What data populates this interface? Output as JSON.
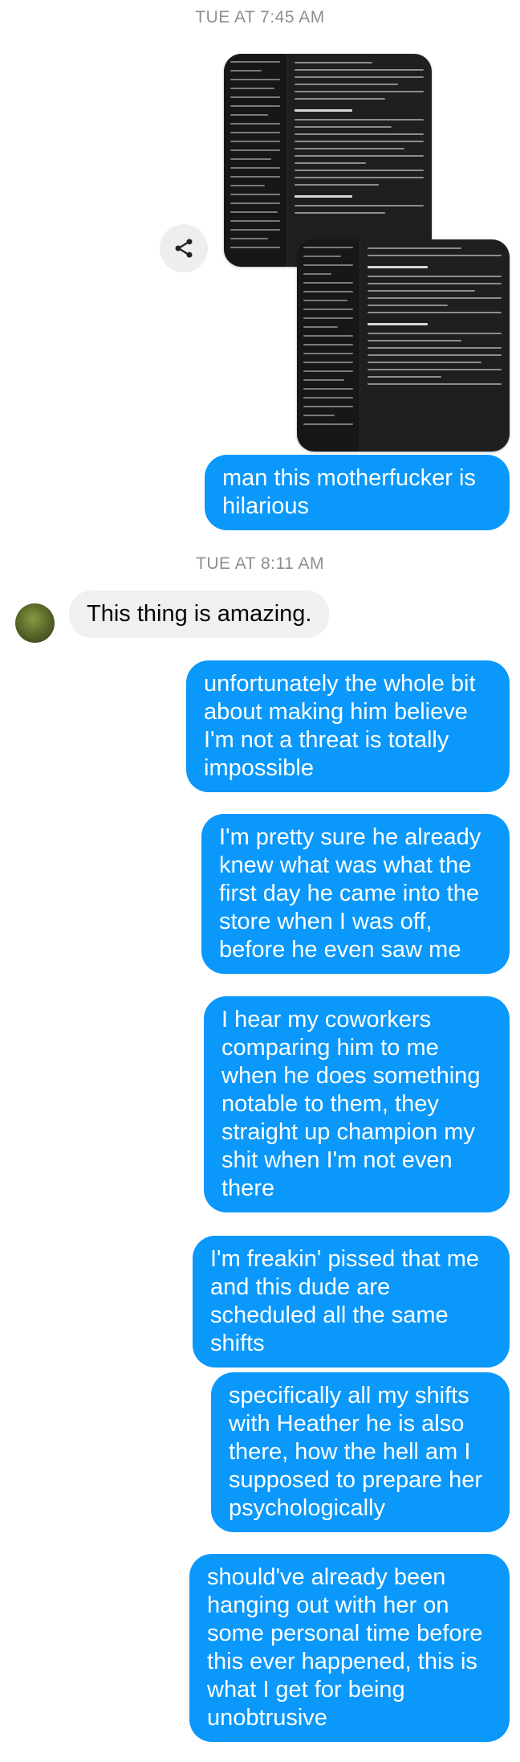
{
  "timestamps": [
    "TUE AT 7:45 AM",
    "TUE AT 8:11 AM"
  ],
  "shared_images": [
    {
      "icon": "shared-screenshot-1"
    },
    {
      "icon": "shared-screenshot-2"
    }
  ],
  "share_icon": "share-icon",
  "contact": {
    "avatar_icon": "avatar"
  },
  "messages": {
    "m1": "man this motherfucker is hilarious",
    "m2": "This thing is amazing.",
    "m3": "unfortunately the whole bit about making him believe I'm not a threat is totally impossible",
    "m4": "I'm pretty sure he already knew what was what the first day he came into the store when I was off, before he even saw me",
    "m5": "I hear my coworkers comparing him to me when he does something notable to them, they straight up champion my shit when I'm not even there",
    "m6": "I'm freakin' pissed that me and this dude are scheduled all the same shifts",
    "m7": "specifically all my shifts with Heather he is also there, how the hell am I supposed to prepare her psychologically",
    "m8": "should've already been hanging out with her on some personal time before this ever happened, this is what I get for being unobtrusive"
  },
  "colors": {
    "outgoing": "#0a98fb",
    "incoming": "#f0f0f0",
    "timestamp": "#8e8e93"
  }
}
